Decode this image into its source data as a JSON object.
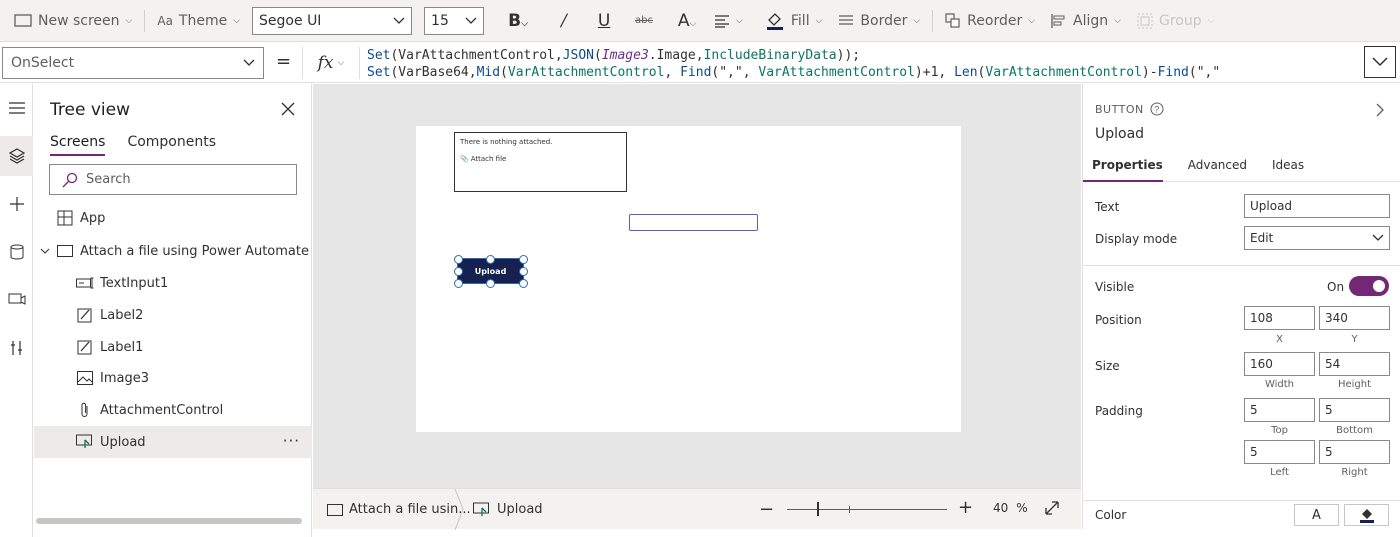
{
  "toolbar": {
    "new_screen": "New screen",
    "theme": "Theme",
    "font": "Segoe UI",
    "font_size": "15",
    "fill": "Fill",
    "border": "Border",
    "reorder": "Reorder",
    "align": "Align",
    "group": "Group"
  },
  "formula": {
    "property": "OnSelect",
    "eq": "=",
    "fx": "fx",
    "line1": [
      {
        "t": "Set",
        "c": "fn"
      },
      {
        "t": "(VarAttachmentControl,",
        "c": ""
      },
      {
        "t": "JSON",
        "c": "fn"
      },
      {
        "t": "(",
        "c": ""
      },
      {
        "t": "Image3",
        "c": "v"
      },
      {
        "t": ".Image,",
        "c": ""
      },
      {
        "t": "IncludeBinaryData",
        "c": "k"
      },
      {
        "t": "));",
        "c": ""
      }
    ],
    "line2": [
      {
        "t": "Set",
        "c": "fn"
      },
      {
        "t": "(VarBase64,",
        "c": ""
      },
      {
        "t": "Mid",
        "c": "fn"
      },
      {
        "t": "(",
        "c": ""
      },
      {
        "t": "VarAttachmentControl",
        "c": "k"
      },
      {
        "t": ", ",
        "c": ""
      },
      {
        "t": "Find",
        "c": "fn"
      },
      {
        "t": "(\",\", ",
        "c": ""
      },
      {
        "t": "VarAttachmentControl",
        "c": "k"
      },
      {
        "t": ")+1, ",
        "c": ""
      },
      {
        "t": "Len",
        "c": "fn"
      },
      {
        "t": "(",
        "c": ""
      },
      {
        "t": "VarAttachmentControl",
        "c": "k"
      },
      {
        "t": ")-",
        "c": ""
      },
      {
        "t": "Find",
        "c": "fn"
      },
      {
        "t": "(\",\"",
        "c": ""
      }
    ]
  },
  "tree": {
    "title": "Tree view",
    "tabs": [
      "Screens",
      "Components"
    ],
    "search_placeholder": "Search",
    "app": "App",
    "screen": "Attach a file using Power Automate",
    "controls": [
      "TextInput1",
      "Label2",
      "Label1",
      "Image3",
      "AttachmentControl",
      "Upload"
    ],
    "more": "···"
  },
  "canvas": {
    "attach_text": "There is nothing attached.",
    "attach_file": "Attach file",
    "button_label": "Upload"
  },
  "status": {
    "crumb_screen": "Attach a file usin...",
    "crumb_control": "Upload",
    "zoom_value": "40",
    "zoom_unit": "%"
  },
  "props": {
    "type": "BUTTON",
    "name": "Upload",
    "tabs": [
      "Properties",
      "Advanced",
      "Ideas"
    ],
    "text_label": "Text",
    "text_value": "Upload",
    "display_mode_label": "Display mode",
    "display_mode_value": "Edit",
    "visible_label": "Visible",
    "visible_value": "On",
    "position_label": "Position",
    "pos_x": "108",
    "pos_y": "340",
    "x_label": "X",
    "y_label": "Y",
    "size_label": "Size",
    "width": "160",
    "height": "54",
    "width_label": "Width",
    "height_label": "Height",
    "padding_label": "Padding",
    "pad_top": "5",
    "pad_bottom": "5",
    "pad_left": "5",
    "pad_right": "5",
    "top_label": "Top",
    "bottom_label": "Bottom",
    "left_label": "Left",
    "right_label": "Right",
    "color_label": "Color",
    "color_text_glyph": "A"
  },
  "colors": {
    "accent": "#742774",
    "button_fill": "#16214f",
    "selection": "#2b6cb0"
  }
}
